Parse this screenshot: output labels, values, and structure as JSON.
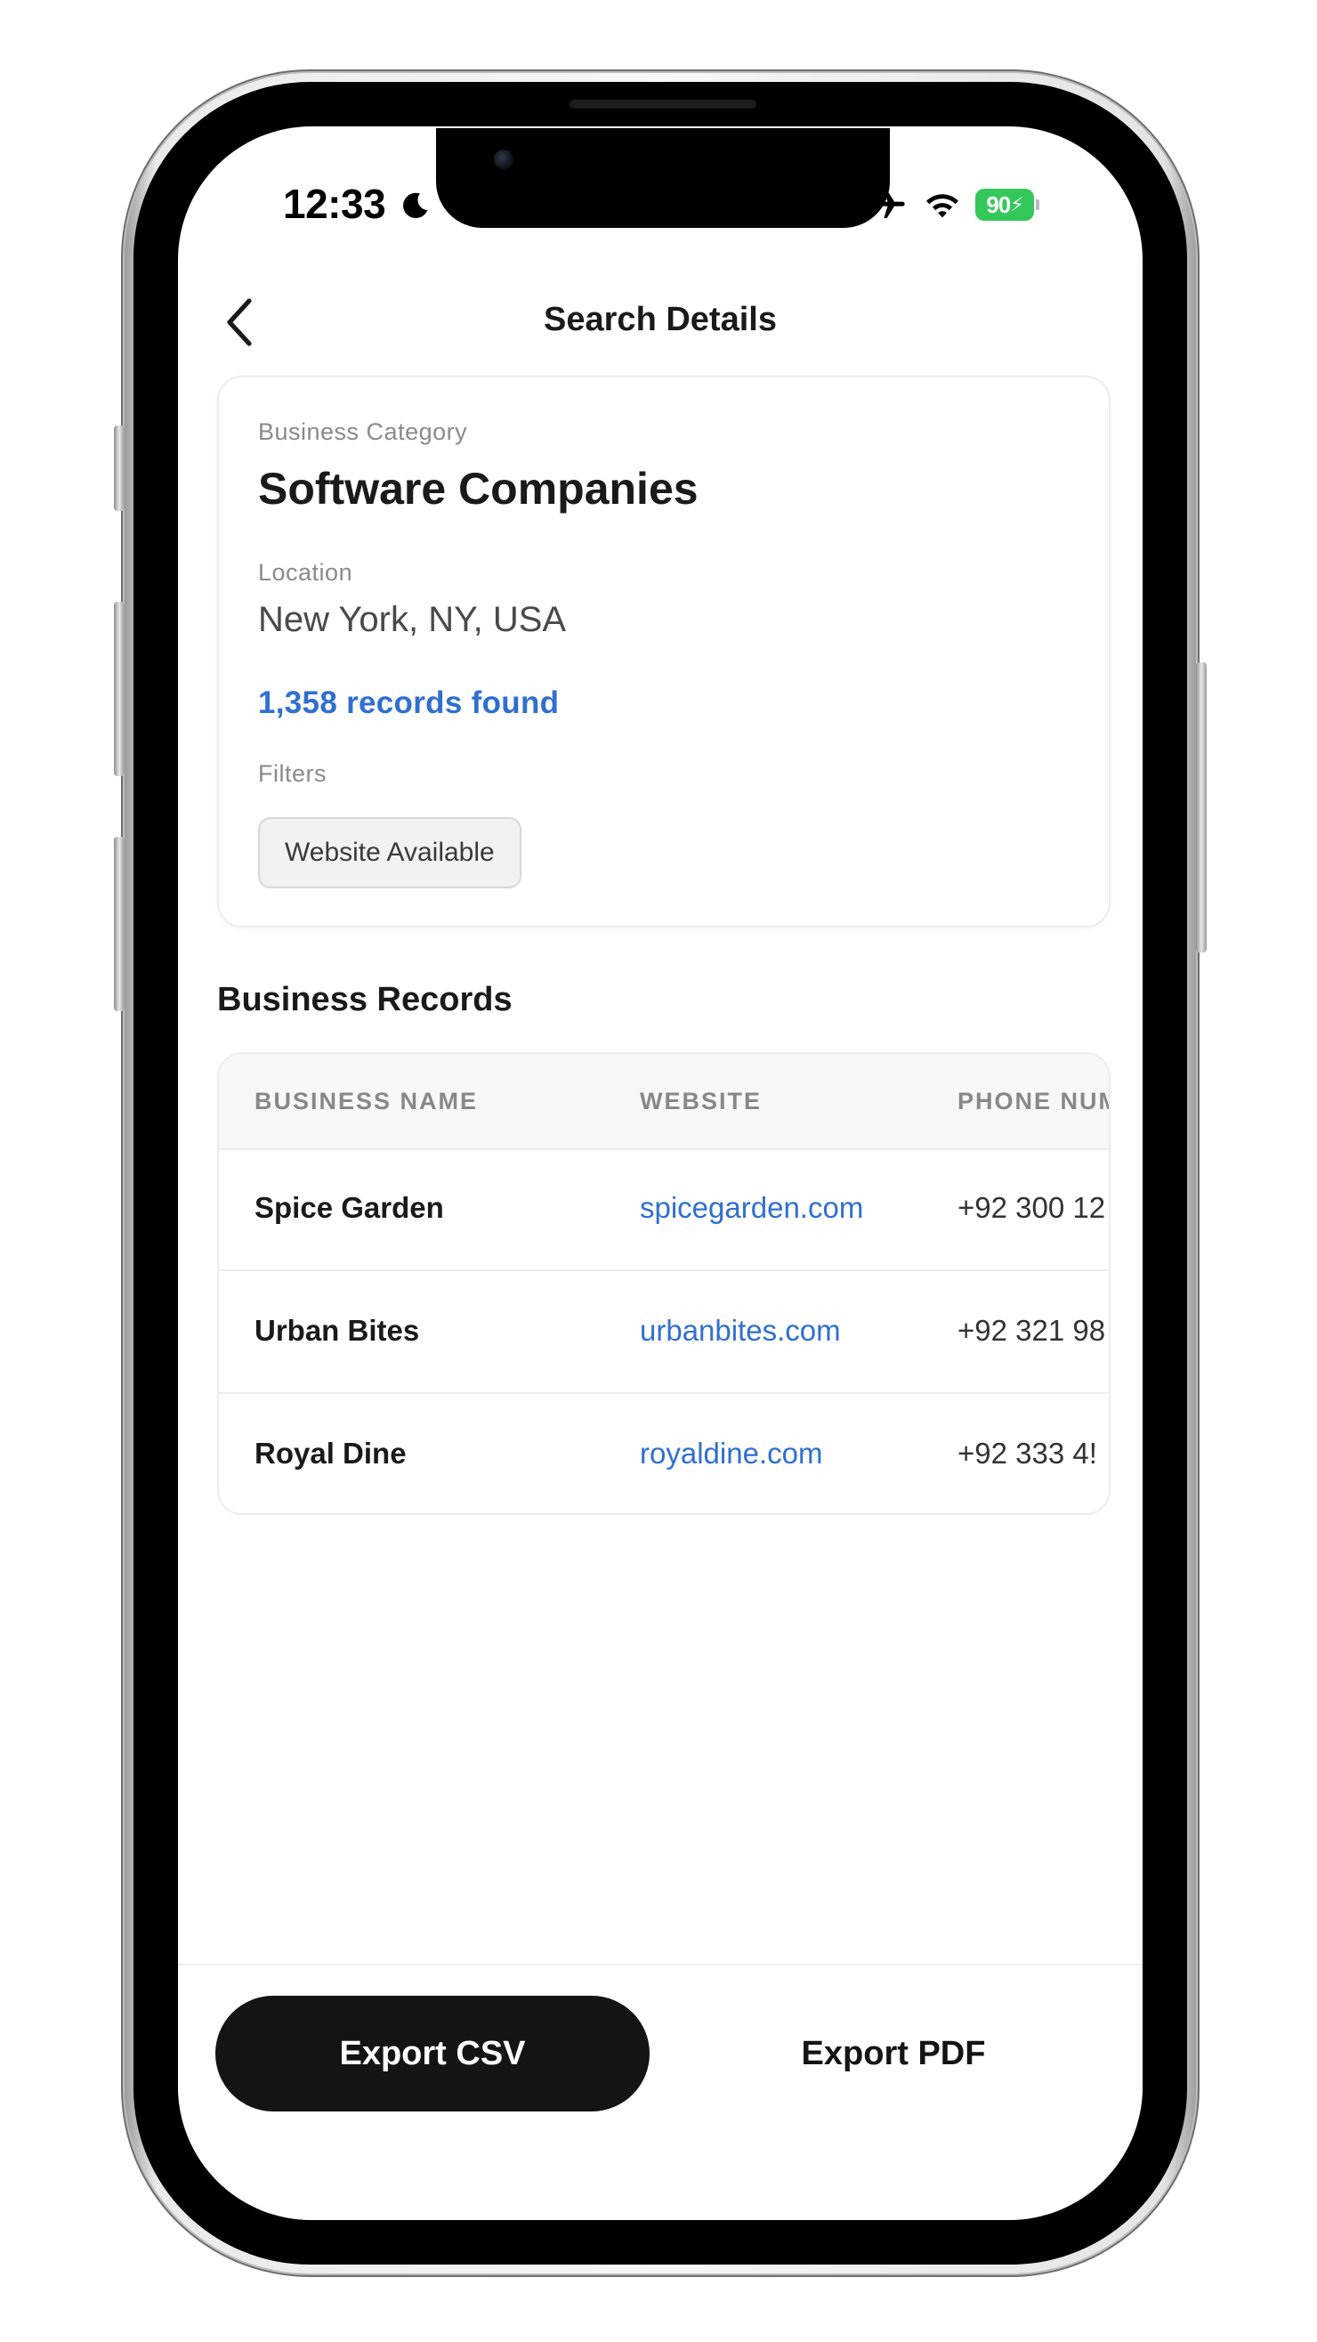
{
  "status_bar": {
    "time": "12:33",
    "battery": "90"
  },
  "nav": {
    "title": "Search Details"
  },
  "summary": {
    "category_label": "Business Category",
    "category_value": "Software Companies",
    "location_label": "Location",
    "location_value": "New York, NY, USA",
    "records_found": "1,358 records found",
    "filters_label": "Filters",
    "filters": [
      "Website Available"
    ]
  },
  "records": {
    "section_title": "Business Records",
    "columns": [
      "BUSINESS NAME",
      "WEBSITE",
      "PHONE NUM"
    ],
    "rows": [
      {
        "name": "Spice Garden",
        "website": "spicegarden.com",
        "phone": "+92 300 12"
      },
      {
        "name": "Urban Bites",
        "website": "urbanbites.com",
        "phone": "+92 321 98"
      },
      {
        "name": "Royal Dine",
        "website": "royaldine.com",
        "phone": "+92 333 4!"
      }
    ]
  },
  "actions": {
    "export_csv": "Export CSV",
    "export_pdf": "Export PDF"
  },
  "colors": {
    "accent": "#2f6fd0",
    "primary_button": "#141414",
    "battery": "#34c759"
  },
  "icons": {
    "back": "chevron-left-icon",
    "moon": "moon-icon",
    "airplane": "airplane-icon",
    "wifi": "wifi-icon",
    "battery": "battery-charging-icon"
  }
}
